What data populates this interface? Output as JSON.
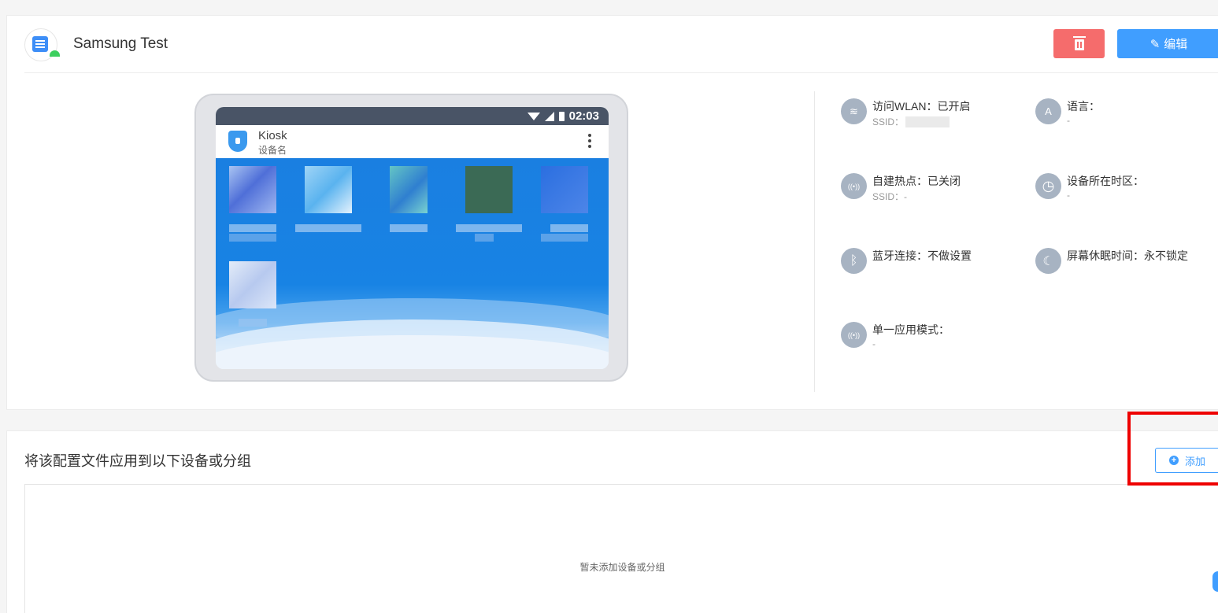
{
  "profile": {
    "title": "Samsung Test",
    "edit_label": "编辑"
  },
  "device": {
    "time": "02:03",
    "app_name": "Kiosk",
    "app_sub": "设备名"
  },
  "settings": [
    {
      "label": "访问WLAN：已开启",
      "sub": "SSID：",
      "icon": "wifi-icon",
      "glyph": "≋"
    },
    {
      "label": "语言：",
      "sub": "-",
      "icon": "language-icon",
      "glyph": "A"
    },
    {
      "label": "自建热点：已关闭",
      "sub": "SSID：-",
      "icon": "hotspot-icon",
      "glyph": "((•))"
    },
    {
      "label": "设备所在时区：",
      "sub": "-",
      "icon": "clock-icon",
      "glyph": "◷"
    },
    {
      "label": "蓝牙连接：不做设置",
      "sub": "",
      "icon": "bluetooth-icon",
      "glyph": "ᛒ"
    },
    {
      "label": "屏幕休眠时间：永不锁定",
      "sub": "",
      "icon": "sleep-icon",
      "glyph": "☾"
    },
    {
      "label": "单一应用模式：",
      "sub": "-",
      "icon": "single-app-icon",
      "glyph": "((•))"
    }
  ],
  "assign": {
    "title": "将该配置文件应用到以下设备或分组",
    "add_label": "添加",
    "empty_text": "暂未添加设备或分组"
  },
  "colors": {
    "primary": "#409eff",
    "danger": "#f56c6c",
    "highlight": "#ee0000"
  }
}
